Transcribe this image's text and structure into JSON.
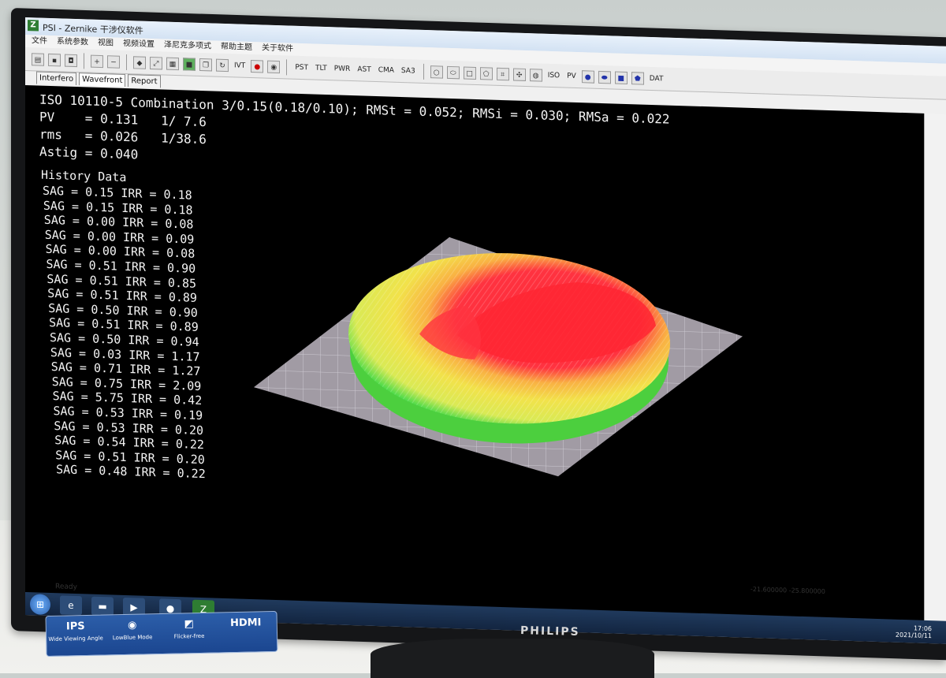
{
  "app": {
    "title": "PSI - Zernike 干涉仪软件",
    "logo_letter": "Z"
  },
  "menu": [
    "文件",
    "系统参数",
    "视图",
    "视频设置",
    "泽尼克多项式",
    "帮助主题",
    "关于软件"
  ],
  "toolbar": {
    "text_buttons_1": [
      "IVT"
    ],
    "text_buttons_2": [
      "PST",
      "TLT",
      "PWR",
      "AST",
      "CMA",
      "SA3"
    ],
    "text_buttons_3": [
      "ISO",
      "PV"
    ],
    "text_buttons_4": [
      "DAT"
    ]
  },
  "tabs": [
    "Interfero",
    "Wavefront",
    "Report"
  ],
  "active_tab": "Wavefront",
  "results": {
    "iso_line": "ISO 10110-5 Combination 3/0.15(0.18/0.10); RMSt = 0.052; RMSi = 0.030; RMSa = 0.022",
    "pv_line": "PV    = 0.131   1/ 7.6",
    "rms_line": "rms   = 0.026   1/38.6",
    "astig_line": "Astig = 0.040"
  },
  "history": {
    "title": "History Data",
    "rows": [
      "SAG = 0.15 IRR = 0.18",
      "SAG = 0.15 IRR = 0.18",
      "SAG = 0.00 IRR = 0.08",
      "SAG = 0.00 IRR = 0.09",
      "SAG = 0.00 IRR = 0.08",
      "SAG = 0.51 IRR = 0.90",
      "SAG = 0.51 IRR = 0.85",
      "SAG = 0.51 IRR = 0.89",
      "SAG = 0.50 IRR = 0.90",
      "SAG = 0.51 IRR = 0.89",
      "SAG = 0.50 IRR = 0.94",
      "SAG = 0.03 IRR = 1.17",
      "SAG = 0.71 IRR = 1.27",
      "SAG = 0.75 IRR = 2.09",
      "SAG = 5.75 IRR = 0.42",
      "SAG = 0.53 IRR = 0.19",
      "SAG = 0.53 IRR = 0.20",
      "SAG = 0.54 IRR = 0.22",
      "SAG = 0.51 IRR = 0.20",
      "SAG = 0.48 IRR = 0.22"
    ]
  },
  "coords": "-21.600000 -25.800000",
  "status": "Ready",
  "tray_time": "17:06",
  "tray_date": "2021/10/11",
  "monitor": {
    "brand": "PHILIPS",
    "sticker": [
      "Wide Viewing Angle",
      "LowBlue Mode",
      "Flicker-free",
      "HDMI"
    ]
  },
  "colors": {
    "view_bg": "#000000",
    "surface_high": "#ff2b3a",
    "surface_mid": "#f2e24a",
    "surface_low": "#39d94a",
    "grid_plane": "#a9a3ad"
  }
}
